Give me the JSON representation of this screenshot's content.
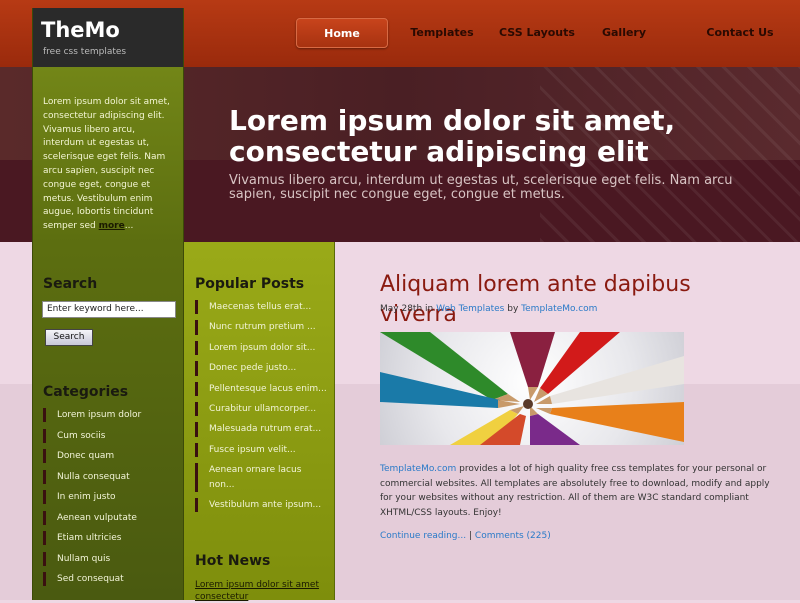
{
  "site": {
    "name": "TheMo",
    "tagline": "free css templates"
  },
  "nav": [
    {
      "label": "Home",
      "active": true
    },
    {
      "label": "Templates"
    },
    {
      "label": "CSS Layouts"
    },
    {
      "label": "Gallery"
    },
    {
      "label": "Contact Us"
    }
  ],
  "hero": {
    "title": "Lorem ipsum dolor sit amet, consectetur adipiscing elit",
    "subtitle": "Vivamus libero arcu, interdum ut egestas ut, scelerisque eget felis. Nam arcu sapien, suscipit nec congue eget, congue et metus."
  },
  "intro": {
    "text": "Lorem ipsum dolor sit amet, consectetur adipiscing elit. Vivamus libero arcu, interdum ut egestas ut, scelerisque eget felis. Nam arcu sapien, suscipit nec congue eget, congue et metus. Vestibulum enim augue, lobortis tincidunt semper sed",
    "more": "more",
    "ellipsis": "..."
  },
  "search": {
    "title": "Search",
    "placeholder": "Enter keyword here...",
    "button": "Search"
  },
  "categories": {
    "title": "Categories",
    "items": [
      "Lorem ipsum dolor",
      "Cum sociis",
      "Donec quam",
      "Nulla consequat",
      "In enim justo",
      "Aenean vulputate",
      "Etiam ultricies",
      "Nullam quis",
      "Sed consequat"
    ]
  },
  "popular": {
    "title": "Popular Posts",
    "items": [
      "Maecenas tellus erat...",
      "Nunc rutrum pretium ...",
      "Lorem ipsum dolor sit...",
      "Donec pede justo...",
      "Pellentesque lacus enim...",
      "Curabitur ullamcorper...",
      "Malesuada rutrum erat...",
      "Fusce ipsum velit...",
      "Aenean ornare lacus non...",
      "Vestibulum ante ipsum..."
    ]
  },
  "hot_news": {
    "title": "Hot News",
    "link": "Lorem ipsum dolor sit amet consectetur"
  },
  "post": {
    "title": "Aliquam lorem ante dapibus viverra",
    "date": "May 28th",
    "in": "in",
    "category": "Web Templates",
    "by": "by",
    "author": "TemplateMo.com",
    "body_link": "TemplateMo.com",
    "body": "provides a lot of high quality free css templates for your personal or commercial websites. All templates are absolutely free to download, modify and apply for your websites without any restriction. All of them are W3C standard compliant XHTML/CSS layouts. Enjoy!",
    "continue": "Continue reading...",
    "separator": "|",
    "comments": "Comments (225)"
  },
  "colors": {
    "accent": "#b73a14",
    "sidebar": "#6a7e14",
    "post_title": "#8a1a10",
    "link": "#2a7ac8"
  }
}
